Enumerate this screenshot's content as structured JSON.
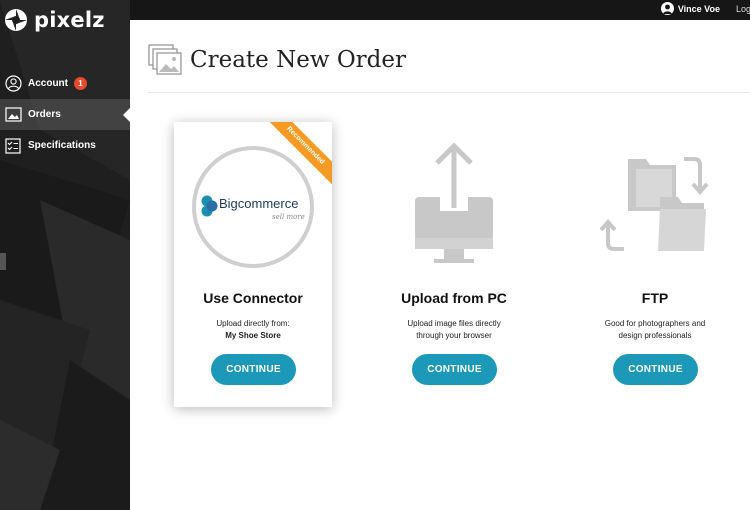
{
  "app": {
    "name": "pixelz"
  },
  "sidebar": {
    "items": [
      {
        "label": "Account",
        "badge": "1"
      },
      {
        "label": "Orders"
      },
      {
        "label": "Specifications"
      }
    ]
  },
  "topbar": {
    "user_name": "Vince Voe",
    "logout_label": "Log"
  },
  "page": {
    "title": "Create New Order"
  },
  "cards": [
    {
      "ribbon": "Recommended",
      "logo_text": "Bigcommerce",
      "logo_sub": "sell more",
      "title": "Use Connector",
      "desc_line1": "Upload directly from:",
      "desc_line2": "My Shoe Store",
      "button": "CONTINUE"
    },
    {
      "title": "Upload from PC",
      "desc_line1": "Upload image files directly",
      "desc_line2": "through your browser",
      "button": "CONTINUE"
    },
    {
      "title": "FTP",
      "desc_line1": "Good for photographers and",
      "desc_line2": "design professionals",
      "button": "CONTINUE"
    }
  ],
  "colors": {
    "accent": "#1c98b8",
    "ribbon": "#f59a23",
    "badge": "#e64a2e",
    "sidebar": "#1f1f1f",
    "icon_gray": "#c8c8c8"
  }
}
